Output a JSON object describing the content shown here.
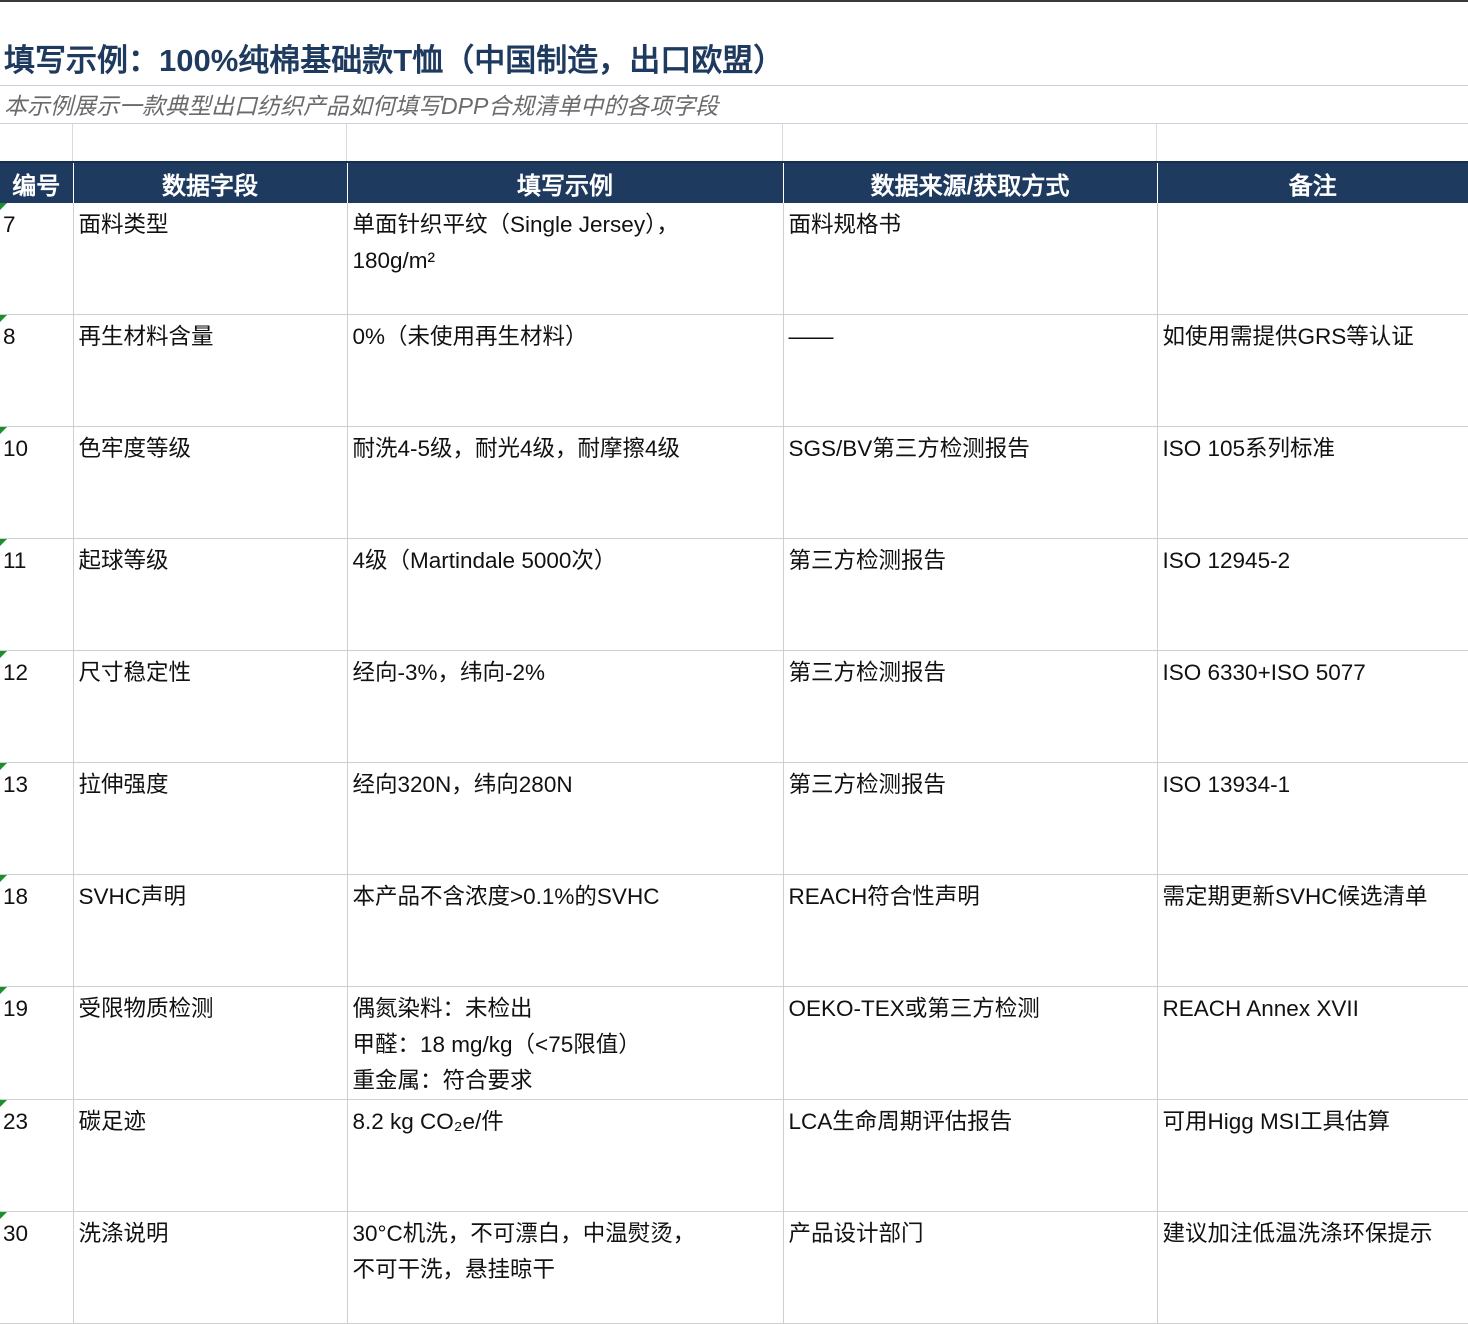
{
  "title": "填写示例：100%纯棉基础款T恤（中国制造，出口欧盟）",
  "subtitle": "本示例展示一款典型出口纺织产品如何填写DPP合规清单中的各项字段",
  "columns": [
    "编号",
    "数据字段",
    "填写示例",
    "数据来源/获取方式",
    "备注"
  ],
  "rows": [
    {
      "no": "7",
      "field": "面料类型",
      "example": [
        "单面针织平纹（Single Jersey），",
        "180g/m²"
      ],
      "source": "面料规格书",
      "note": ""
    },
    {
      "no": "8",
      "field": "再生材料含量",
      "example": [
        "0%（未使用再生材料）"
      ],
      "source": "——",
      "note": "如使用需提供GRS等认证"
    },
    {
      "no": "10",
      "field": "色牢度等级",
      "example": [
        "耐洗4-5级，耐光4级，耐摩擦4级"
      ],
      "source": "SGS/BV第三方检测报告",
      "note": "ISO 105系列标准"
    },
    {
      "no": "11",
      "field": "起球等级",
      "example": [
        "4级（Martindale 5000次）"
      ],
      "source": "第三方检测报告",
      "note": "ISO 12945-2"
    },
    {
      "no": "12",
      "field": "尺寸稳定性",
      "example": [
        "经向-3%，纬向-2%"
      ],
      "source": "第三方检测报告",
      "note": "ISO 6330+ISO 5077"
    },
    {
      "no": "13",
      "field": "拉伸强度",
      "example": [
        "经向320N，纬向280N"
      ],
      "source": "第三方检测报告",
      "note": "ISO 13934-1"
    },
    {
      "no": "18",
      "field": "SVHC声明",
      "example": [
        "本产品不含浓度>0.1%的SVHC"
      ],
      "source": "REACH符合性声明",
      "note": "需定期更新SVHC候选清单"
    },
    {
      "no": "19",
      "field": "受限物质检测",
      "example": [
        "偶氮染料：未检出",
        "甲醛：18 mg/kg（<75限值）",
        "重金属：符合要求"
      ],
      "source": "OEKO-TEX或第三方检测",
      "note": "REACH Annex XVII"
    },
    {
      "no": "23",
      "field": "碳足迹",
      "example": [
        "8.2 kg CO₂e/件"
      ],
      "source": "LCA生命周期评估报告",
      "note": "可用Higg MSI工具估算"
    },
    {
      "no": "30",
      "field": "洗涤说明",
      "example": [
        "30°C机洗，不可漂白，中温熨烫，",
        "不可干洗，悬挂晾干"
      ],
      "source": "产品设计部门",
      "note": "建议加注低温洗涤环保提示"
    }
  ]
}
